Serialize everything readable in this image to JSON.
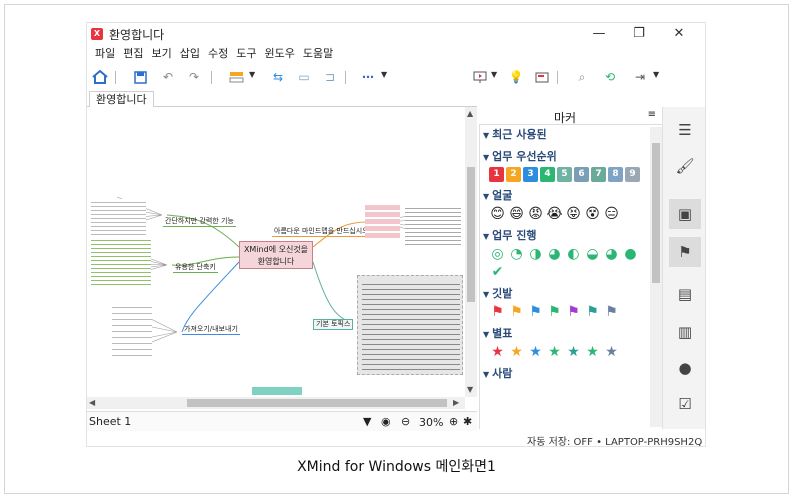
{
  "window": {
    "title": "환영합니다",
    "logo": "X",
    "minimize": "—",
    "maximize": "❐",
    "close": "✕"
  },
  "menu": [
    "파일",
    "편집",
    "보기",
    "삽입",
    "수정",
    "도구",
    "윈도우",
    "도움말"
  ],
  "toolbar": {
    "icons": [
      "home-icon",
      "save-icon",
      "undo-icon",
      "redo-icon",
      "topic-icon",
      "relationship-icon",
      "boundary-icon",
      "summary-icon",
      "more-icon",
      "presentation-icon",
      "brainstorm-icon",
      "pitch-icon",
      "search-icon",
      "share-icon",
      "export-icon"
    ]
  },
  "tab": {
    "label": "환영합니다"
  },
  "mindmap": {
    "central": "XMind에 오신것을\n환영합니다",
    "branches": [
      "간단하지만 강력한 기능",
      "아름다운 마인드맵을 만드십시오",
      "유용한 단축키",
      "가져오기/내보내기",
      "기본 토픽스"
    ]
  },
  "statusbar": {
    "sheet": "Sheet 1",
    "filter": "▼",
    "eye": "◉",
    "zoom_out": "⊖",
    "zoom": "30%",
    "zoom_in": "⊕",
    "fit": "✱"
  },
  "panel": {
    "title": "마커",
    "menu_icon": "≡",
    "sections": [
      {
        "name": "최근 사용된",
        "items": []
      },
      {
        "name": "업무 우선순위",
        "priorities": [
          {
            "n": "1",
            "c": "#e8343f"
          },
          {
            "n": "2",
            "c": "#f5a623"
          },
          {
            "n": "3",
            "c": "#2d8ee0"
          },
          {
            "n": "4",
            "c": "#2bb673"
          },
          {
            "n": "5",
            "c": "#6fb3a3"
          },
          {
            "n": "6",
            "c": "#7a9eb5"
          },
          {
            "n": "7",
            "c": "#6aaa99"
          },
          {
            "n": "8",
            "c": "#7fa3c2"
          },
          {
            "n": "9",
            "c": "#9aa7b4"
          }
        ]
      },
      {
        "name": "얼굴",
        "glyphs": [
          "😊",
          "😄",
          "😡",
          "😭",
          "😝",
          "😵",
          "😑"
        ]
      },
      {
        "name": "업무 진행",
        "glyphs": [
          "◎",
          "◔",
          "◑",
          "◕",
          "◐",
          "◒",
          "◕",
          "●",
          "✔"
        ],
        "color": "#2bb673"
      },
      {
        "name": "깃발",
        "glyphs": [
          "⚑",
          "⚑",
          "⚑",
          "⚑",
          "⚑",
          "⚑",
          "⚑"
        ],
        "colors": [
          "#e8343f",
          "#f5a623",
          "#2d8ee0",
          "#2bb673",
          "#a23bd2",
          "#2b9e95",
          "#6a7f9c"
        ]
      },
      {
        "name": "별표",
        "glyphs": [
          "★",
          "★",
          "★",
          "★",
          "★",
          "★",
          "★"
        ],
        "colors": [
          "#e8343f",
          "#f5a623",
          "#2d8ee0",
          "#2bb673",
          "#2b9e95",
          "#2bb673",
          "#6a7f9c"
        ]
      },
      {
        "name": "사람",
        "glyphs": []
      }
    ]
  },
  "autosave": "자동 저장: OFF  •  LAPTOP-PRH9SH2Q",
  "sidebar": [
    "outline-icon",
    "format-icon",
    "image-icon",
    "marker-icon",
    "sticker-icon",
    "notes-icon",
    "comment-icon",
    "task-icon"
  ],
  "caption": "XMind for Windows 메인화면1"
}
